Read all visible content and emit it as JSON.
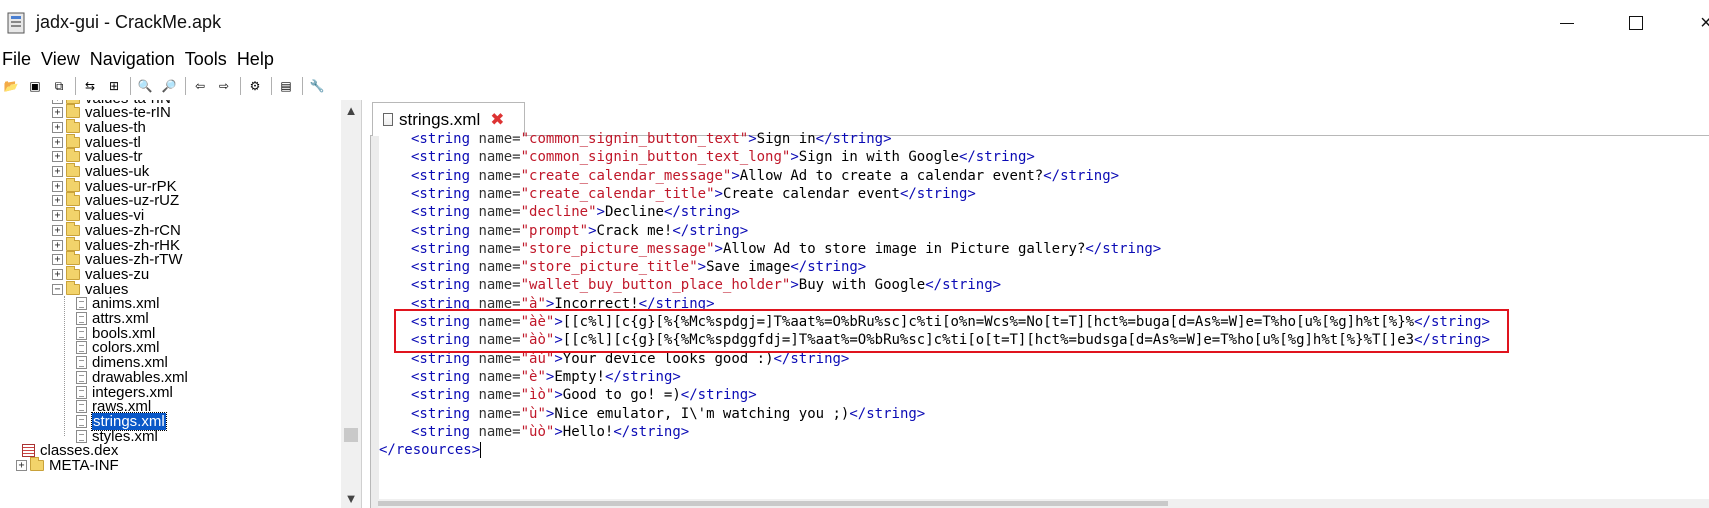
{
  "window": {
    "title": "jadx-gui - CrackMe.apk",
    "icon": "jadx-app-icon",
    "controls": {
      "minimize": "minimize-icon",
      "maximize": "maximize-icon",
      "close": "×"
    }
  },
  "menu": {
    "items": [
      "File",
      "View",
      "Navigation",
      "Tools",
      "Help"
    ]
  },
  "toolbar": {
    "buttons": [
      "open-folder-icon",
      "save-icon",
      "save-all-icon",
      "sync-icon",
      "flatten-packages-icon",
      "search-icon",
      "find-icon",
      "back-icon",
      "forward-icon",
      "deobfuscation-icon",
      "log-icon",
      "preferences-icon"
    ],
    "glyphs": [
      "📂",
      "▣",
      "⧉",
      "⇆",
      "⊞",
      "🔍",
      "🔎",
      "⇦",
      "⇨",
      "⚙",
      "▤",
      "🔧"
    ]
  },
  "tree": {
    "items": [
      {
        "label": "values-ta-rIN",
        "kind": "folder"
      },
      {
        "label": "values-te-rIN",
        "kind": "folder"
      },
      {
        "label": "values-th",
        "kind": "folder"
      },
      {
        "label": "values-tl",
        "kind": "folder"
      },
      {
        "label": "values-tr",
        "kind": "folder"
      },
      {
        "label": "values-uk",
        "kind": "folder"
      },
      {
        "label": "values-ur-rPK",
        "kind": "folder"
      },
      {
        "label": "values-uz-rUZ",
        "kind": "folder"
      },
      {
        "label": "values-vi",
        "kind": "folder"
      },
      {
        "label": "values-zh-rCN",
        "kind": "folder"
      },
      {
        "label": "values-zh-rHK",
        "kind": "folder"
      },
      {
        "label": "values-zh-rTW",
        "kind": "folder"
      },
      {
        "label": "values-zu",
        "kind": "folder"
      },
      {
        "label": "values",
        "kind": "folder-open"
      },
      {
        "label": "anims.xml",
        "kind": "file"
      },
      {
        "label": "attrs.xml",
        "kind": "file"
      },
      {
        "label": "bools.xml",
        "kind": "file"
      },
      {
        "label": "colors.xml",
        "kind": "file"
      },
      {
        "label": "dimens.xml",
        "kind": "file"
      },
      {
        "label": "drawables.xml",
        "kind": "file"
      },
      {
        "label": "integers.xml",
        "kind": "file"
      },
      {
        "label": "raws.xml",
        "kind": "file"
      },
      {
        "label": "strings.xml",
        "kind": "file",
        "selected": true
      },
      {
        "label": "styles.xml",
        "kind": "file"
      },
      {
        "label": "classes.dex",
        "kind": "dex"
      },
      {
        "label": "META-INF",
        "kind": "folder"
      }
    ]
  },
  "editor": {
    "tab": {
      "label": "strings.xml",
      "close": "✖"
    },
    "lines": [
      {
        "name": "common_signin_button_text",
        "text": "Sign in"
      },
      {
        "name": "common_signin_button_text_long",
        "text": "Sign in with Google"
      },
      {
        "name": "create_calendar_message",
        "text": "Allow Ad to create a calendar event?"
      },
      {
        "name": "create_calendar_title",
        "text": "Create calendar event"
      },
      {
        "name": "decline",
        "text": "Decline"
      },
      {
        "name": "prompt",
        "text": "Crack me!"
      },
      {
        "name": "store_picture_message",
        "text": "Allow Ad to store image in Picture gallery?"
      },
      {
        "name": "store_picture_title",
        "text": "Save image"
      },
      {
        "name": "wallet_buy_button_place_holder",
        "text": "Buy with Google"
      },
      {
        "name": "à",
        "text": "Incorrect!"
      },
      {
        "name": "àè",
        "text": "[[c%l][c{g}[%{%Mc%spdgj=]T%aat%=O%bRu%sc]c%ti[o%n=Wcs%=No[t=T][hct%=buga[d=As%=W]e=T%ho[u%[%g]h%t[%}%"
      },
      {
        "name": "àò",
        "text": "[[c%l][c{g}[%{%Mc%spdggfdj=]T%aat%=O%bRu%sc]c%ti[o[t=T][hct%=budsga[d=As%=W]e=T%ho[u%[%g]h%t[%}%T[]e3"
      },
      {
        "name": "àù",
        "text": "Your device looks good :)"
      },
      {
        "name": "è",
        "text": "Empty!"
      },
      {
        "name": "ìò",
        "text": "Good to go! =)"
      },
      {
        "name": "ù",
        "text": "Nice emulator, I\\'m watching you ;)"
      },
      {
        "name": "ùò",
        "text": "Hello!"
      }
    ],
    "closing_tag": "</resources>",
    "syntax": {
      "open_tag": "<string",
      "attr": "name=",
      "close_tag": "</string>"
    },
    "colors": {
      "tag": "#0b0bb5",
      "value": "#c0182a",
      "highlight": "#e0141e"
    },
    "highlighted_lines": [
      10,
      11
    ]
  }
}
